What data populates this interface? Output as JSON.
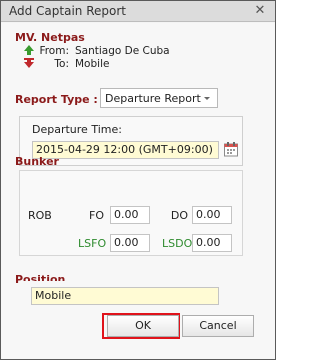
{
  "window": {
    "title": "Add Captain Report",
    "close_glyph": "✕"
  },
  "vessel": {
    "name": "MV. Netpas",
    "from_label": "From:",
    "from_value": "Santiago De Cuba",
    "to_label": "To:",
    "to_value": "Mobile",
    "from_icon": "green-up-arrow-icon",
    "to_icon": "red-down-arrow-icon"
  },
  "report_type": {
    "label": "Report Type :",
    "selected": "Departure Report"
  },
  "departure": {
    "label": "Departure Time:",
    "value": "2015-04-29 12:00 (GMT+09:00)"
  },
  "bunker": {
    "title": "Bunker",
    "rob_label": "ROB",
    "fo_label": "FO",
    "fo_value": "0.00",
    "do_label": "DO",
    "do_value": "0.00",
    "lsfo_label": "LSFO",
    "lsfo_value": "0.00",
    "lsdo_label": "LSDO",
    "lsdo_value": "0.00"
  },
  "position": {
    "title": "Position",
    "value": "Mobile"
  },
  "buttons": {
    "ok": "OK",
    "cancel": "Cancel"
  },
  "colors": {
    "section_title": "#8b1a1a",
    "low_sulphur_label": "#2e8b2e",
    "input_highlight": "#fffbd4",
    "ok_focus_border": "#e0131b"
  }
}
